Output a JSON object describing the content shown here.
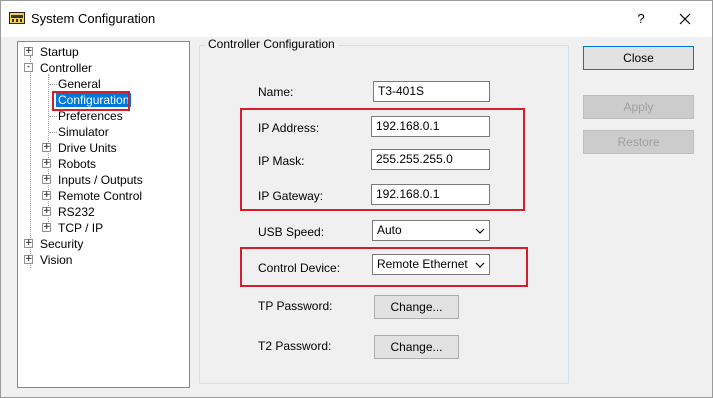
{
  "window": {
    "title": "System Configuration",
    "help_glyph": "?"
  },
  "tree": {
    "items": [
      {
        "label": "Startup",
        "expander": "+"
      },
      {
        "label": "Controller",
        "expander": "-"
      },
      {
        "label": "General"
      },
      {
        "label": "Configuration",
        "selected": true
      },
      {
        "label": "Preferences"
      },
      {
        "label": "Simulator"
      },
      {
        "label": "Drive Units",
        "expander": "+"
      },
      {
        "label": "Robots",
        "expander": "+"
      },
      {
        "label": "Inputs / Outputs",
        "expander": "+"
      },
      {
        "label": "Remote Control",
        "expander": "+"
      },
      {
        "label": "RS232",
        "expander": "+"
      },
      {
        "label": "TCP / IP",
        "expander": "+"
      },
      {
        "label": "Security",
        "expander": "+"
      },
      {
        "label": "Vision",
        "expander": "+"
      }
    ]
  },
  "group": {
    "title": "Controller Configuration"
  },
  "form": {
    "name_label": "Name:",
    "name_value": "T3-401S",
    "ip_label": "IP Address:",
    "ip_value": "192.168.0.1",
    "mask_label": "IP Mask:",
    "mask_value": "255.255.255.0",
    "gateway_label": "IP Gateway:",
    "gateway_value": "192.168.0.1",
    "usb_label": "USB Speed:",
    "usb_value": "Auto",
    "control_label": "Control Device:",
    "control_value": "Remote Ethernet",
    "tp_label": "TP Password:",
    "tp_button": "Change...",
    "t2_label": "T2 Password:",
    "t2_button": "Change..."
  },
  "buttons": {
    "close": "Close",
    "apply": "Apply",
    "restore": "Restore"
  },
  "colors": {
    "selection": "#0078d7",
    "highlight_box": "#d21f2b"
  },
  "icons": {
    "app": "controller-icon",
    "close": "close-icon",
    "dropdown": "chevron-down-icon"
  }
}
